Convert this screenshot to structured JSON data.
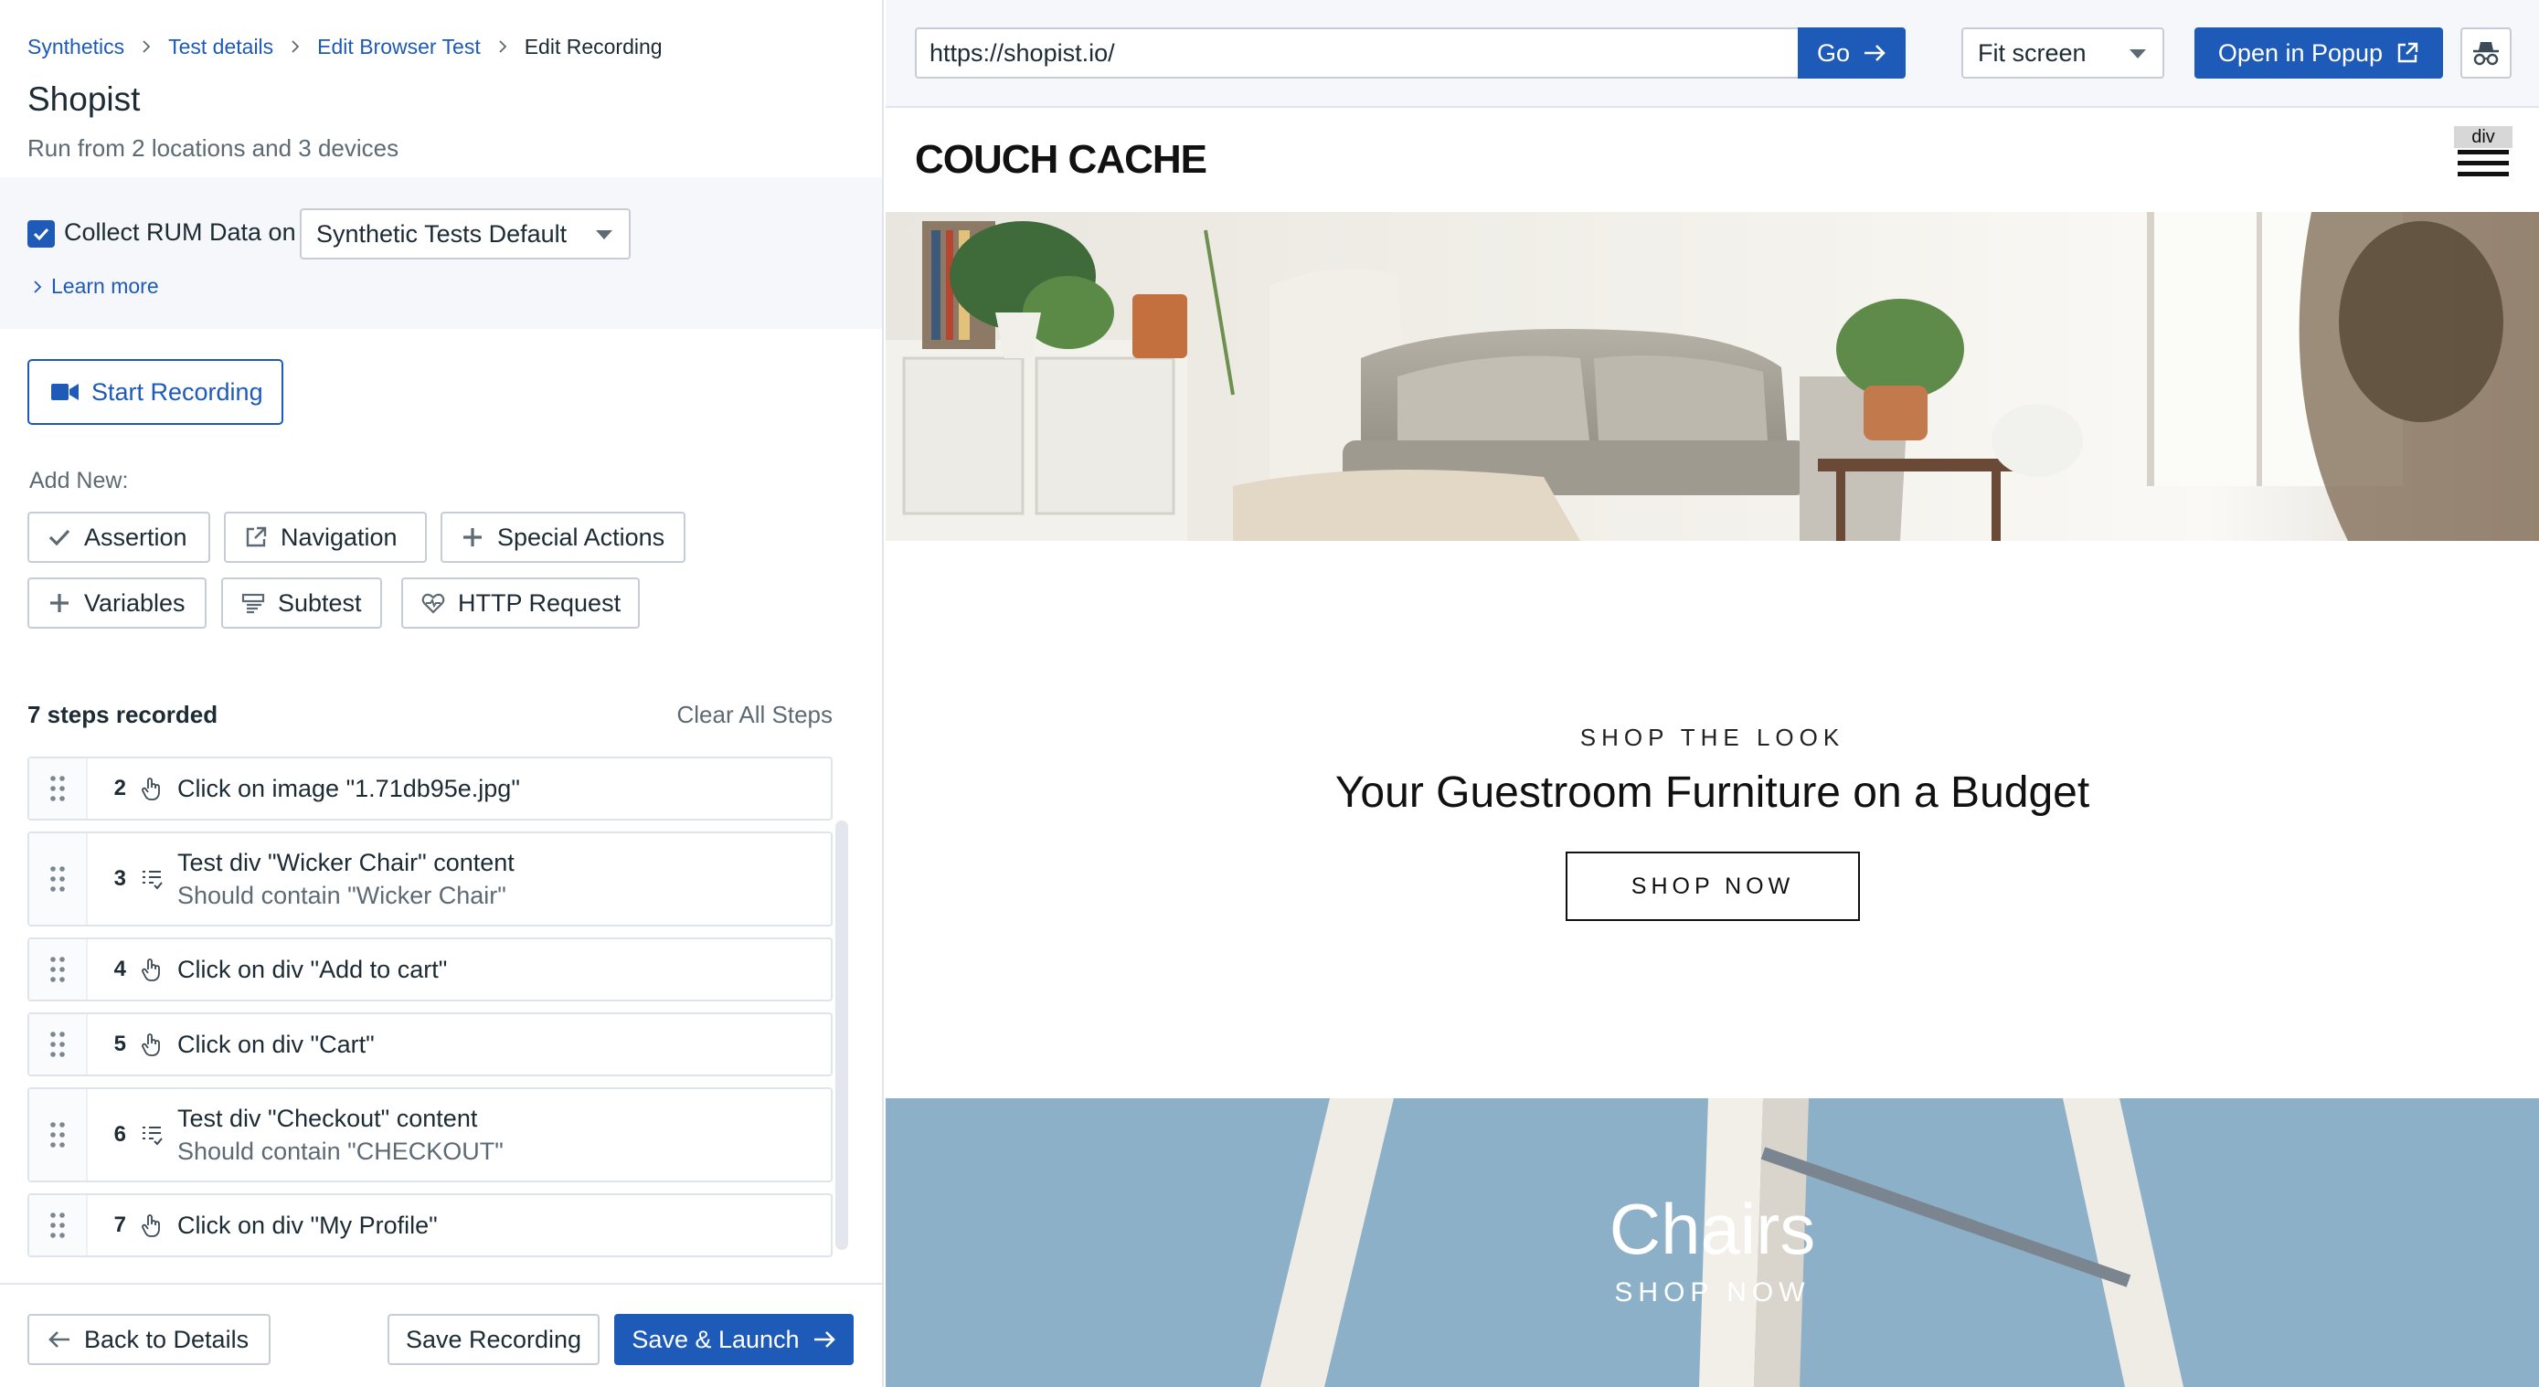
{
  "breadcrumb": [
    {
      "label": "Synthetics",
      "link": true
    },
    {
      "label": "Test details",
      "link": true
    },
    {
      "label": "Edit Browser Test",
      "link": true
    },
    {
      "label": "Edit Recording",
      "link": false
    }
  ],
  "page": {
    "title": "Shopist",
    "subtitle": "Run from 2 locations and 3 devices"
  },
  "rum": {
    "checked": true,
    "label": "Collect RUM Data on",
    "selected": "Synthetic Tests Default",
    "learn_more": "Learn more"
  },
  "recording": {
    "start_label": "Start Recording"
  },
  "add_new": {
    "label": "Add New:",
    "buttons": [
      "Assertion",
      "Navigation",
      "Special Actions",
      "Variables",
      "Subtest",
      "HTTP Request"
    ]
  },
  "steps": {
    "count_label": "7 steps recorded",
    "clear_label": "Clear All Steps",
    "items": [
      {
        "num": "2",
        "type": "click",
        "text": "Click on image \"1.71db95e.jpg\"",
        "sub": ""
      },
      {
        "num": "3",
        "type": "assert",
        "text": "Test div \"Wicker Chair\" content",
        "sub": "Should contain \"Wicker Chair\""
      },
      {
        "num": "4",
        "type": "click",
        "text": "Click on div \"Add to cart\"",
        "sub": ""
      },
      {
        "num": "5",
        "type": "click",
        "text": "Click on div \"Cart\"",
        "sub": ""
      },
      {
        "num": "6",
        "type": "assert",
        "text": "Test div \"Checkout\" content",
        "sub": "Should contain \"CHECKOUT\""
      },
      {
        "num": "7",
        "type": "click",
        "text": "Click on div \"My Profile\"",
        "sub": ""
      }
    ]
  },
  "footer": {
    "back_label": "Back to Details",
    "save_label": "Save Recording",
    "launch_label": "Save & Launch"
  },
  "browser": {
    "url": "https://shopist.io/",
    "go_label": "Go",
    "fit_label": "Fit screen",
    "popup_label": "Open in Popup"
  },
  "site": {
    "logo": "COUCH CACHE",
    "element_tag": "div",
    "promo_kicker": "SHOP THE LOOK",
    "promo_title": "Your Guestroom Furniture on a Budget",
    "promo_button": "SHOP NOW",
    "category_title": "Chairs",
    "category_sub": "SHOP NOW"
  },
  "colors": {
    "accent": "#1e5ab8",
    "text": "#1c2b34",
    "muted": "#5d6a74"
  }
}
